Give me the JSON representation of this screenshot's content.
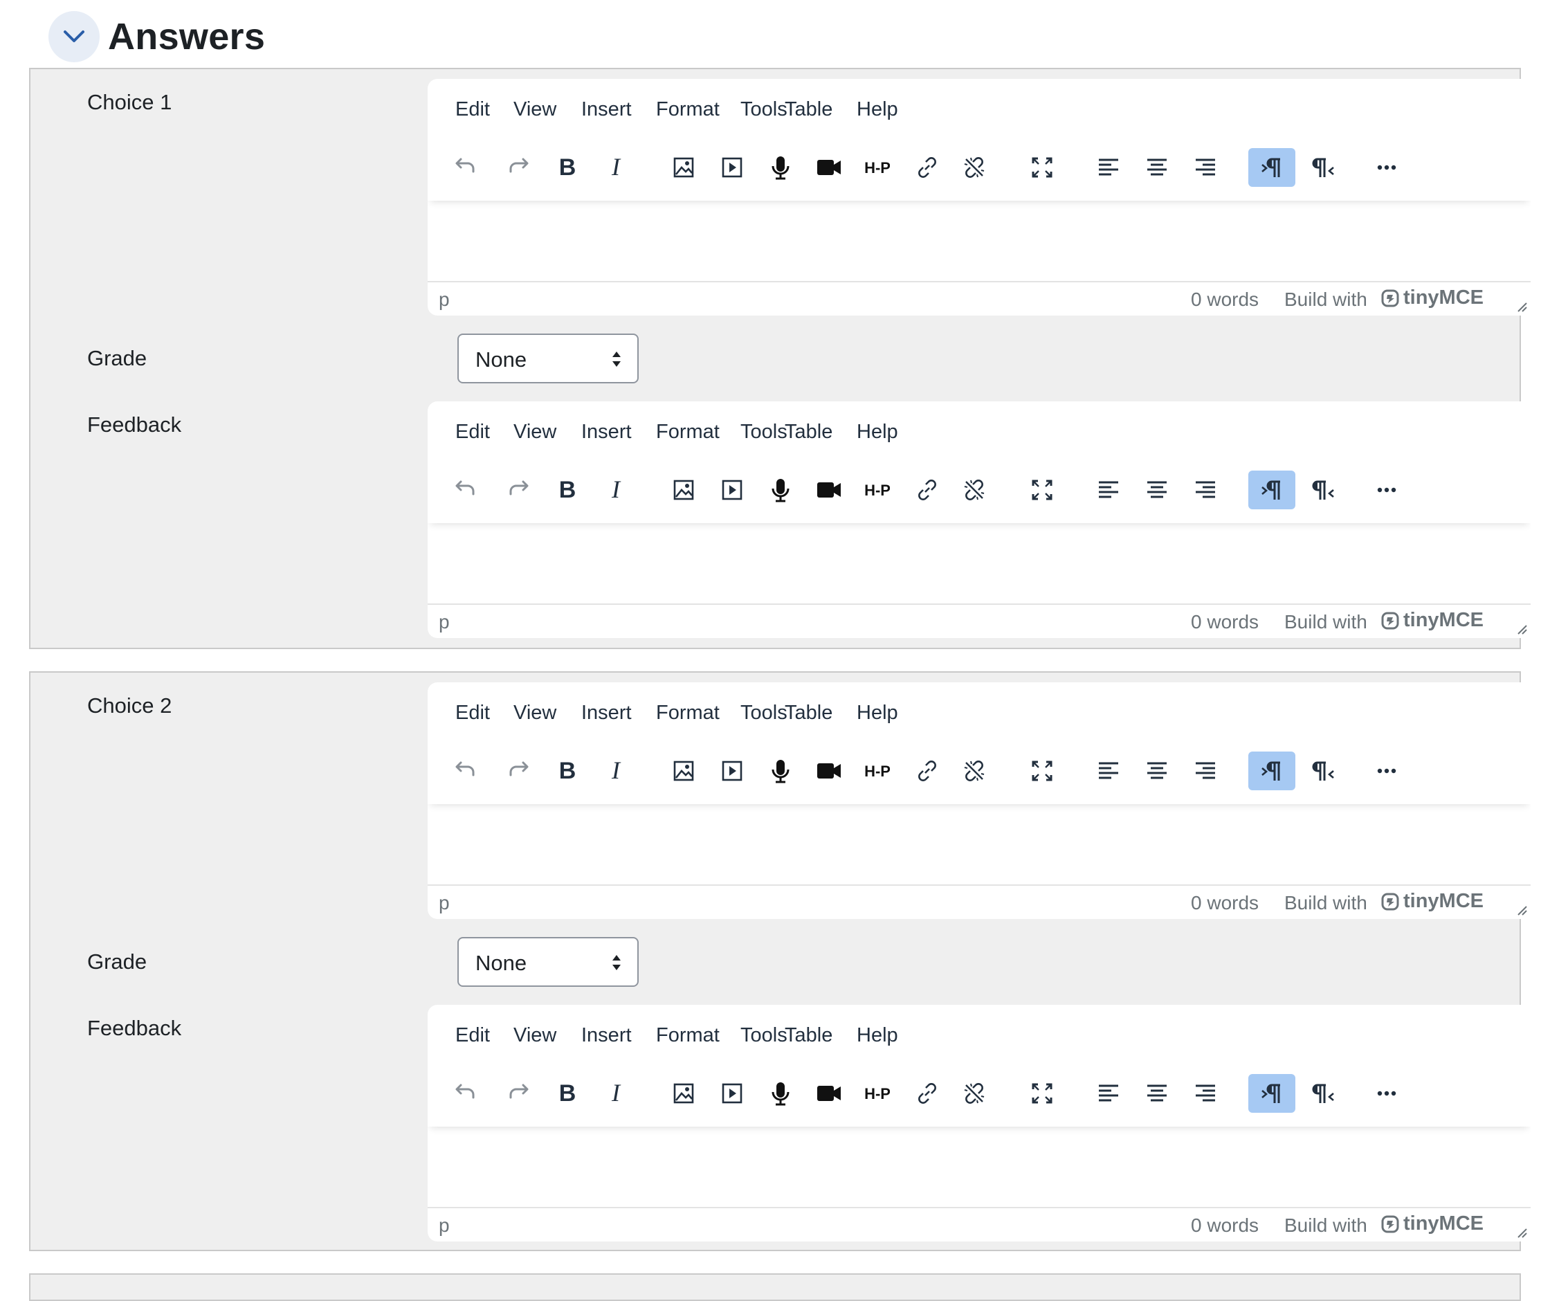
{
  "section": {
    "title": "Answers"
  },
  "answers": [
    {
      "choice_label": "Choice 1",
      "grade_label": "Grade",
      "grade_value": "None",
      "feedback_label": "Feedback"
    },
    {
      "choice_label": "Choice 2",
      "grade_label": "Grade",
      "grade_value": "None",
      "feedback_label": "Feedback"
    }
  ],
  "editor": {
    "menus": [
      "Edit",
      "View",
      "Insert",
      "Format",
      "Tools",
      "Table",
      "Help"
    ],
    "toolbar": [
      "undo-icon",
      "redo-icon",
      "bold-icon",
      "italic-icon",
      "image-icon",
      "media-icon",
      "microphone-icon",
      "video-camera-icon",
      "h5p-icon",
      "link-icon",
      "unlink-icon",
      "fullscreen-icon",
      "align-left-icon",
      "align-center-icon",
      "align-right-icon",
      "ltr-icon",
      "rtl-icon",
      "more-icon"
    ],
    "path": "p",
    "word_count": "0 words",
    "brand_text": "Build with",
    "brand_name": "tinyMCE"
  },
  "colors": {
    "accent_active": "#a6c9f3",
    "panel_bg": "#efefef",
    "toggle_bg": "#e7edf6"
  }
}
